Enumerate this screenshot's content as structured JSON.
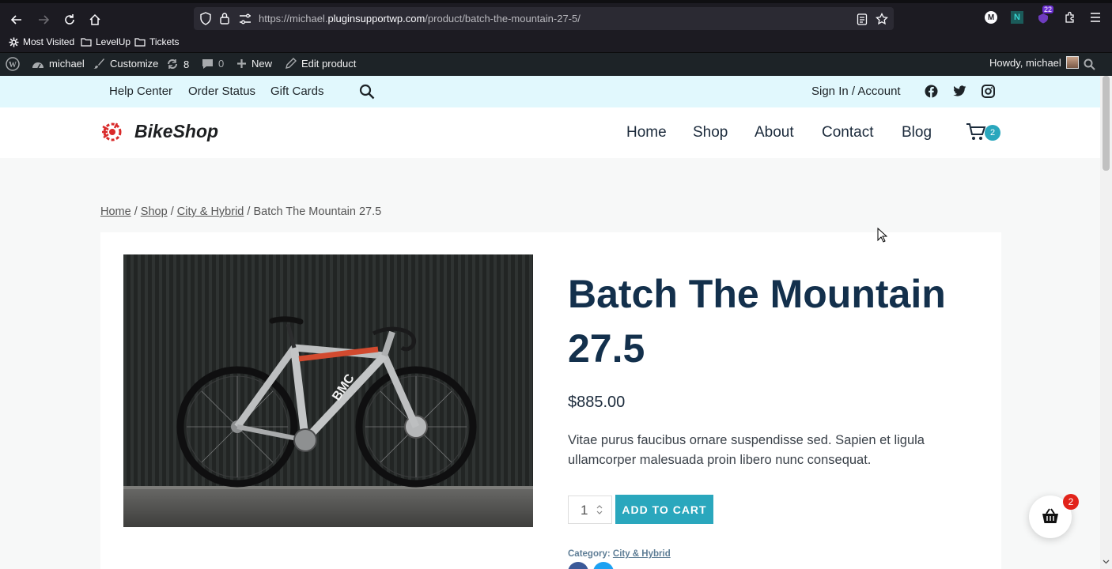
{
  "browser": {
    "url_prefix": "https://michael.",
    "url_domain": "pluginsupportwp.com",
    "url_path": "/product/batch-the-mountain-27-5/",
    "extension_badge": "22",
    "profile_letter": "M",
    "ext_letter": "N",
    "bookmarks": [
      "Most Visited",
      "LevelUp",
      "Tickets"
    ]
  },
  "admin_bar": {
    "site_name": "michael",
    "customize": "Customize",
    "updates_count": "8",
    "comments_count": "0",
    "new_label": "New",
    "edit_label": "Edit product",
    "howdy": "Howdy, michael"
  },
  "topbar": {
    "links": [
      "Help Center",
      "Order Status",
      "Gift Cards"
    ],
    "account": "Sign In / Account"
  },
  "header": {
    "logo_text": "BikeShop",
    "nav": [
      "Home",
      "Shop",
      "About",
      "Contact",
      "Blog"
    ],
    "cart_count": "2"
  },
  "breadcrumb": {
    "items": [
      "Home",
      "Shop",
      "City & Hybrid"
    ],
    "separator": "/",
    "current": "Batch The Mountain 27.5"
  },
  "product": {
    "title": "Batch The Mountain 27.5",
    "price": "$885.00",
    "description": "Vitae purus faucibus ornare suspendisse sed. Sapien et ligula ullamcorper malesuada proin libero nunc consequat.",
    "quantity": "1",
    "add_to_cart": "ADD TO CART",
    "category_label": "Category:",
    "category_value": "City & Hybrid",
    "bike_brand_text": "BMC"
  },
  "floating_cart": {
    "count": "2"
  },
  "colors": {
    "accent": "#2aa7bd",
    "title": "#13304c",
    "topbar_bg": "#e1f8fd",
    "badge_red": "#e2231a"
  }
}
